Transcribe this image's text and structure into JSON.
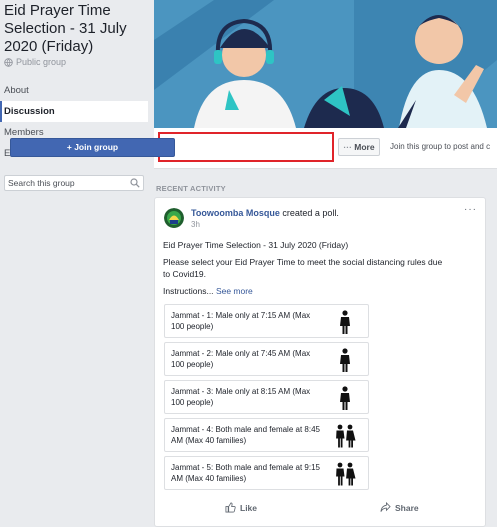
{
  "group": {
    "title": "Eid Prayer Time Selection - 31 July 2020 (Friday)",
    "privacy": "Public group"
  },
  "sidebar": {
    "items": [
      {
        "label": "About"
      },
      {
        "label": "Discussion"
      },
      {
        "label": "Members"
      },
      {
        "label": "Events"
      }
    ],
    "search_placeholder": "Search this group"
  },
  "actions": {
    "join_label": "+ Join group",
    "more_label": "More",
    "hint": "Join this group to post and c"
  },
  "recent_activity_label": "RECENT ACTIVITY",
  "post": {
    "author": "Toowoomba Mosque",
    "action_text": " created a poll.",
    "time": "3h",
    "title": "Eid Prayer Time Selection - 31 July 2020 (Friday)",
    "body_line1": "Please select your Eid Prayer Time to meet the social distancing rules due",
    "body_line2": "to Covid19.",
    "instructions": "Instructions...",
    "see_more": "See more",
    "options": [
      {
        "text": "Jammat - 1: Male only at 7:15 AM (Max 100 people)",
        "icon": "male-person-icon"
      },
      {
        "text": "Jammat - 2: Male only at 7:45 AM (Max 100 people)",
        "icon": "male-person-icon"
      },
      {
        "text": "Jammat - 3: Male only at 8:15 AM (Max 100 people)",
        "icon": "male-person-icon"
      },
      {
        "text": "Jammat - 4: Both male and female at 8:45 AM (Max 40 families)",
        "icon": "male-female-icon"
      },
      {
        "text": "Jammat - 5: Both male and female at 9:15 AM (Max 40 families)",
        "icon": "male-female-icon"
      }
    ],
    "like_label": "Like",
    "share_label": "Share"
  },
  "colors": {
    "accent": "#4267b2",
    "highlight_box": "#e0242a",
    "page_bg": "#e9ebee"
  }
}
